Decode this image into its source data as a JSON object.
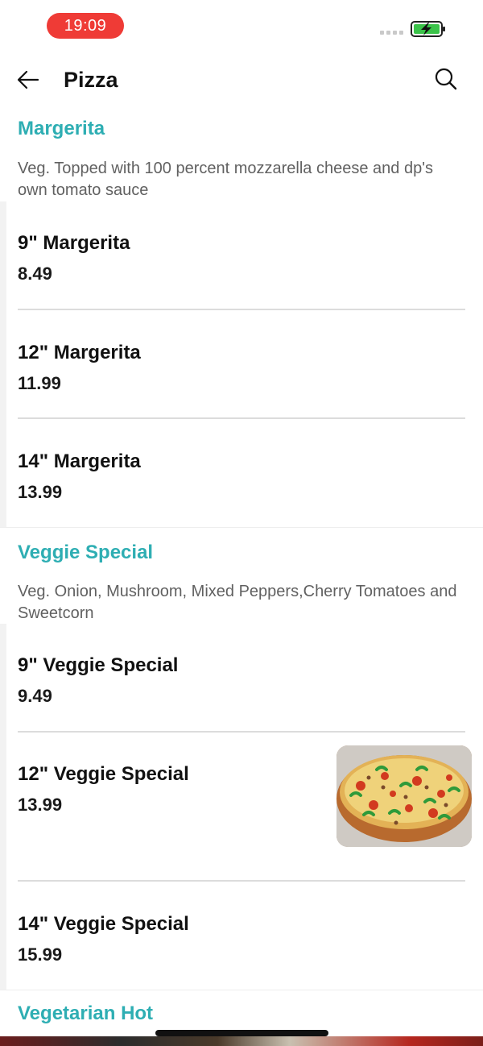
{
  "status_bar": {
    "time": "19:09",
    "accent": "#ef3b36",
    "battery_state": "charging"
  },
  "header": {
    "title": "Pizza",
    "back_icon": "arrow-left-icon",
    "search_icon": "search-icon"
  },
  "colors": {
    "section_title": "#2eaeb3",
    "text": "#111111",
    "description": "#616161"
  },
  "sections": [
    {
      "title": "Margerita",
      "description": "Veg. Topped with 100 percent mozzarella cheese and dp's own tomato sauce",
      "items": [
        {
          "name": "9\" Margerita",
          "price": "8.49"
        },
        {
          "name": "12\" Margerita",
          "price": "11.99"
        },
        {
          "name": "14\" Margerita",
          "price": "13.99"
        }
      ]
    },
    {
      "title": "Veggie Special",
      "description": "Veg. Onion, Mushroom, Mixed Peppers,Cherry Tomatoes and Sweetcorn",
      "items": [
        {
          "name": "9\" Veggie Special",
          "price": "9.49"
        },
        {
          "name": "12\" Veggie Special",
          "price": "13.99",
          "image": "veggie-pizza-photo"
        },
        {
          "name": "14\" Veggie Special",
          "price": "15.99"
        }
      ]
    },
    {
      "title": "Vegetarian Hot"
    }
  ]
}
